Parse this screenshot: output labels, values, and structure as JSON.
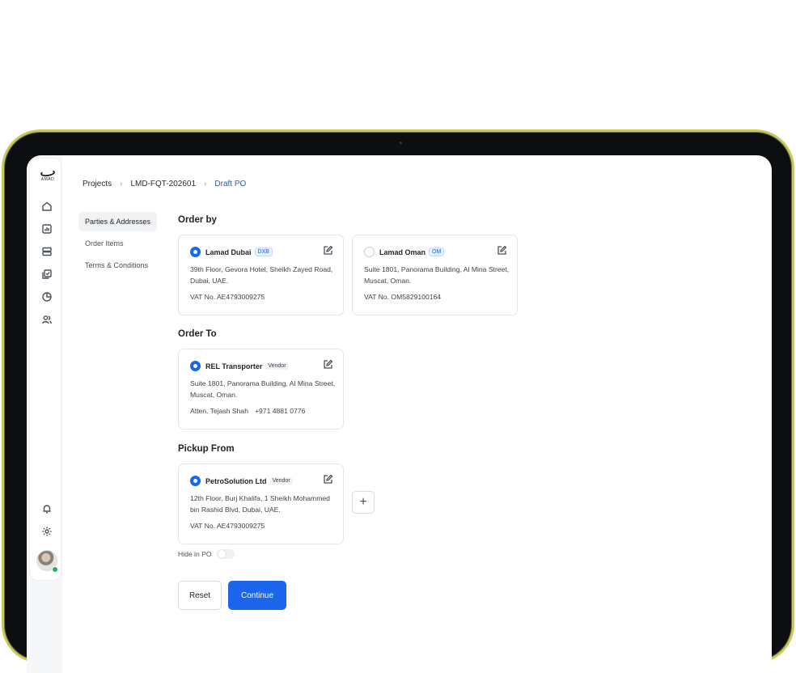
{
  "logo": {
    "text": "AMAD"
  },
  "sidebar": {
    "icons": [
      "home-icon",
      "reports-icon",
      "layers-icon",
      "tasks-icon",
      "analytics-icon",
      "users-icon",
      "bell-icon",
      "settings-icon"
    ]
  },
  "breadcrumb": {
    "items": [
      "Projects",
      "LMD-FQT-202601",
      "Draft PO"
    ]
  },
  "subnav": {
    "items": [
      "Parties & Addresses",
      "Order Items",
      "Terms & Conditions"
    ],
    "active": "Parties & Addresses"
  },
  "order_by": {
    "title": "Order by",
    "cards": [
      {
        "name": "Lamad Dubai",
        "badge": "DXB",
        "selected": true,
        "address": "39th Floor, Gevora Hotel, Sheikh Zayed Road, Dubai, UAE.",
        "extra": "VAT No. AE4793009275"
      },
      {
        "name": "Lamad Oman",
        "badge": "OM",
        "selected": false,
        "address": "Suite 1801, Panorama Building, Al Mina Street, Muscat, Oman.",
        "extra": "VAT No. OM5829100164"
      }
    ]
  },
  "order_to": {
    "title": "Order To",
    "card": {
      "name": "REL Transporter",
      "badge": "Vendor",
      "selected": true,
      "address": "Suite 1801, Panorama Building, Al Mina Street, Muscat, Oman.",
      "contact": "Atten. Tejash Shah",
      "phone": "+971 4881 0776"
    }
  },
  "pickup_from": {
    "title": "Pickup From",
    "card": {
      "name": "PetroSolution Ltd",
      "badge": "Vendor",
      "selected": true,
      "address": "12th Floor, Burj Khalifa, 1 Sheikh Mohammed bin Rashid Blvd, Dubai, UAE.",
      "extra": "VAT No. AE4793009275"
    },
    "add_symbol": "+"
  },
  "hide_in_po": {
    "label": "Hide in PO",
    "on": false
  },
  "actions": {
    "reset_label": "Reset",
    "continue_label": "Continue"
  },
  "colors": {
    "accent": "#1c66ee",
    "frame": "#0d0e10",
    "frame_edge": "#c7c95a"
  }
}
